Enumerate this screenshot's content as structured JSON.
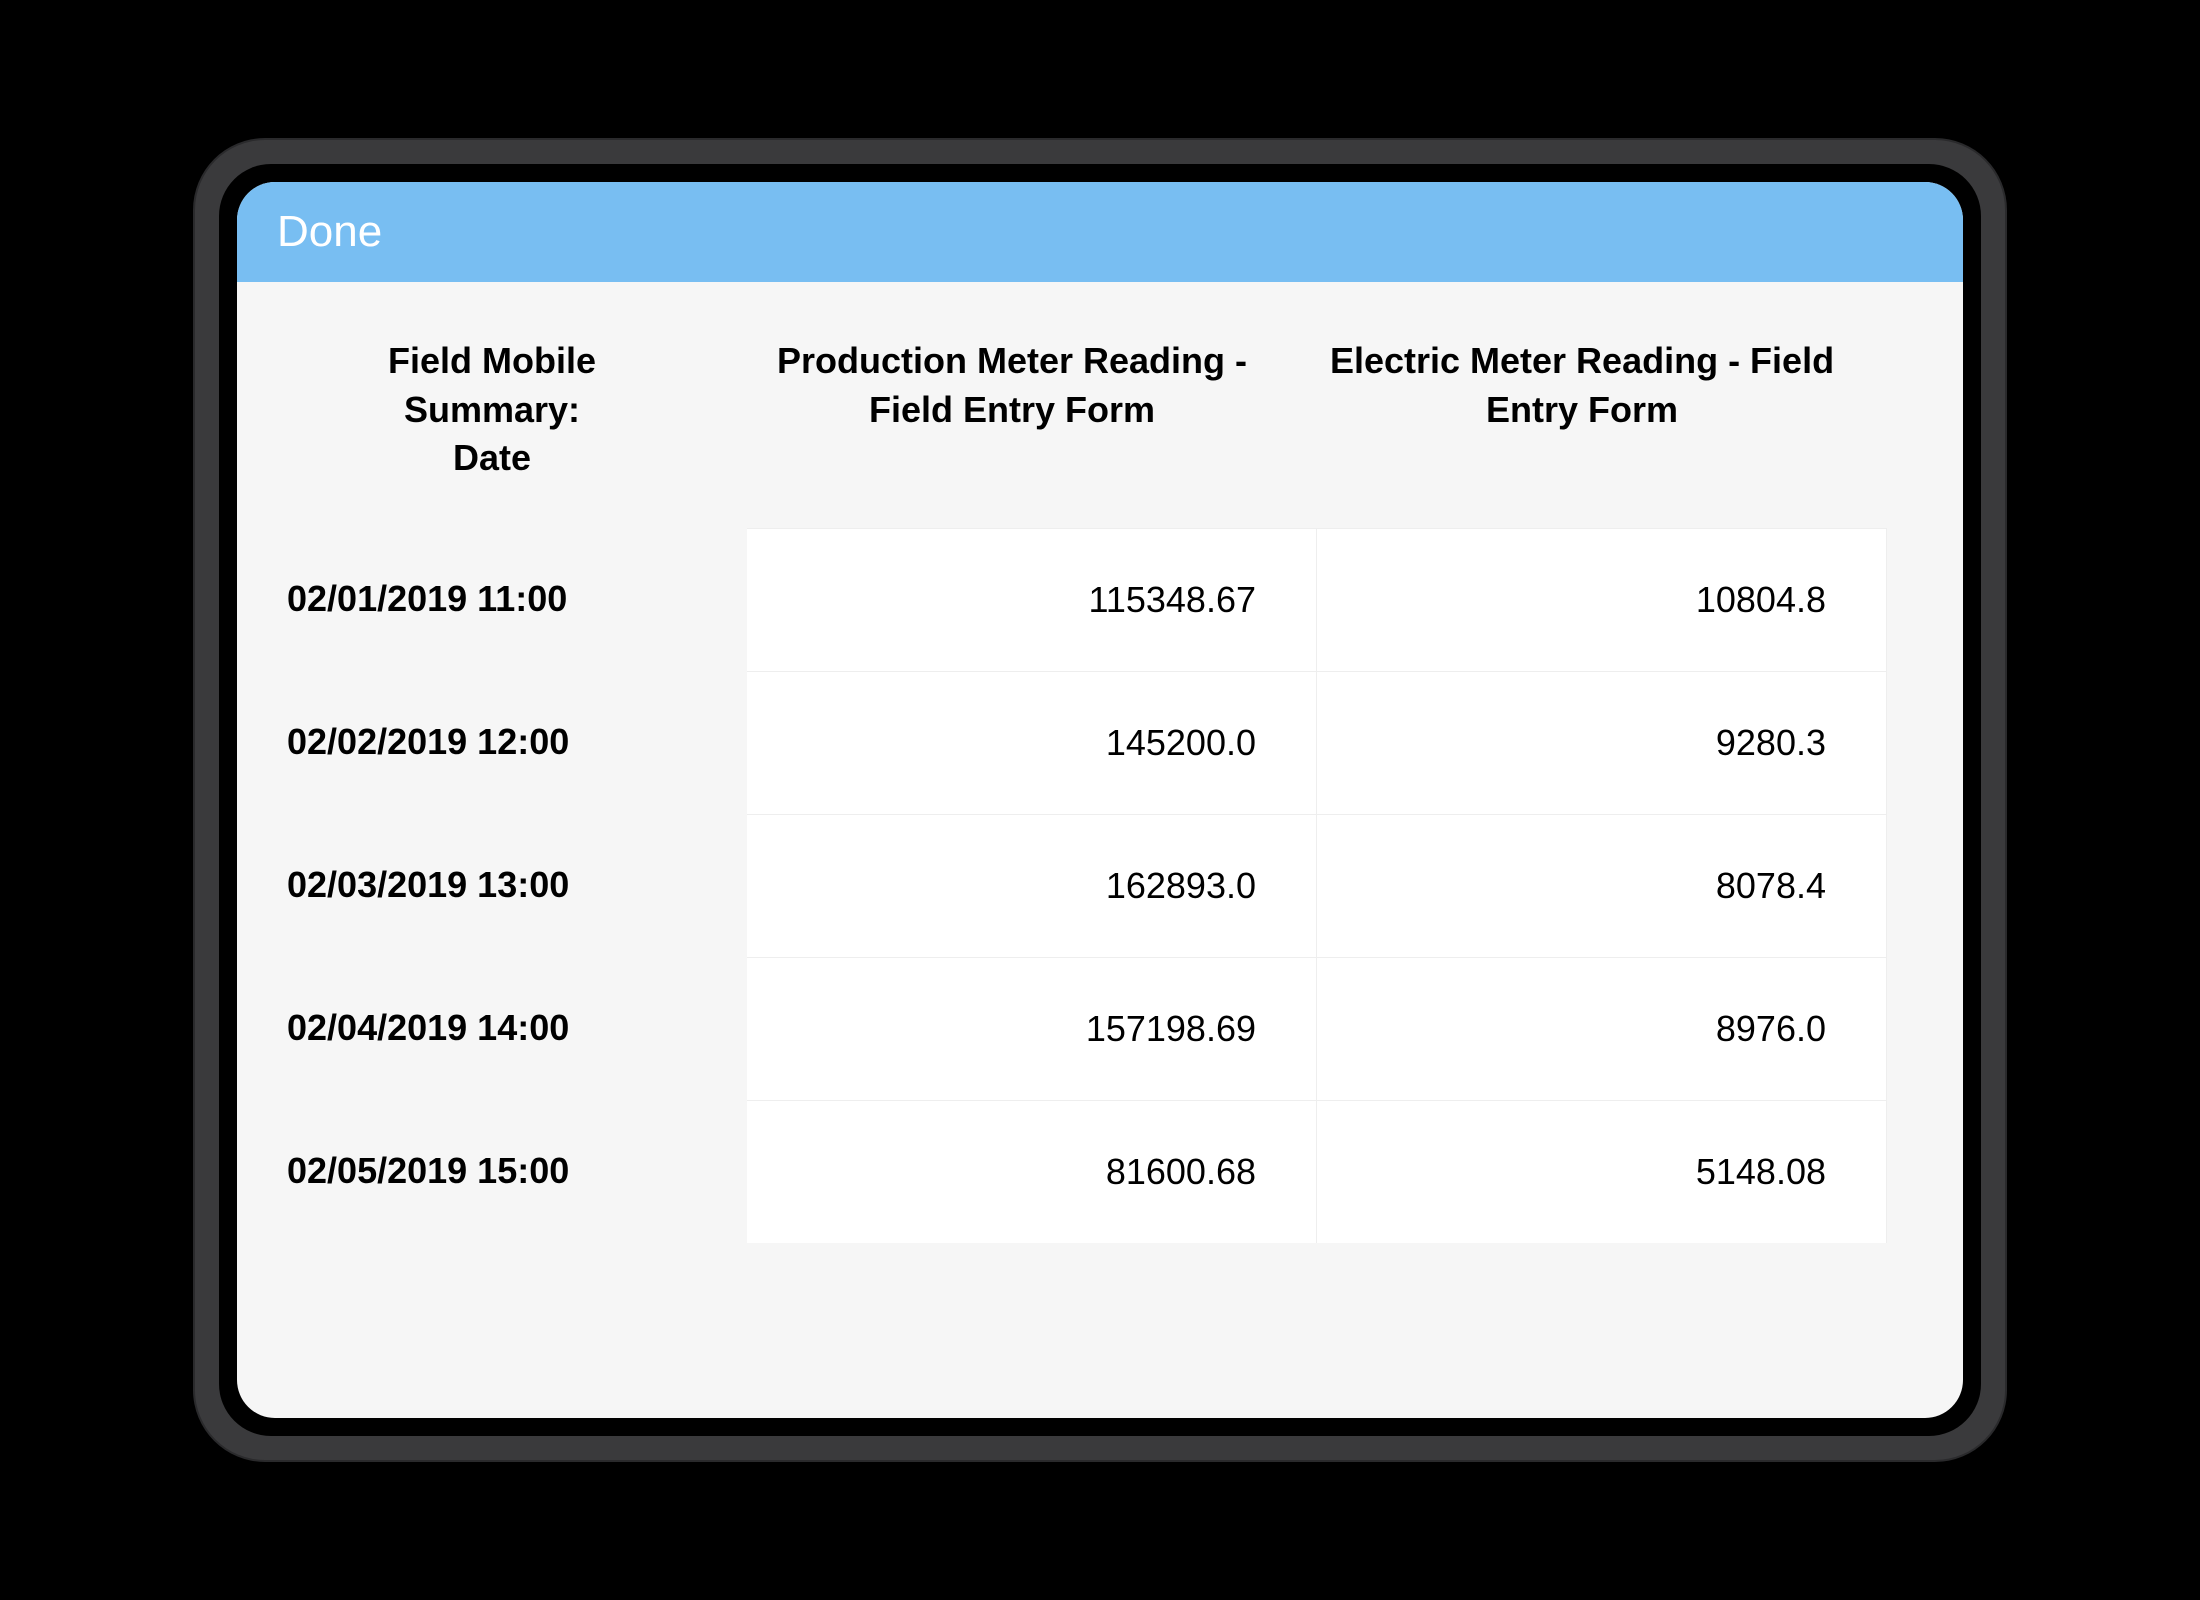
{
  "header": {
    "done_label": "Done"
  },
  "table": {
    "columns": {
      "date": "Field Mobile Summary:\nDate",
      "production": "Production Meter Reading - Field Entry Form",
      "electric": "Electric Meter Reading - Field Entry Form"
    },
    "rows": [
      {
        "date": "02/01/2019 11:00",
        "production": "115348.67",
        "electric": "10804.8"
      },
      {
        "date": "02/02/2019 12:00",
        "production": "145200.0",
        "electric": "9280.3"
      },
      {
        "date": "02/03/2019 13:00",
        "production": "162893.0",
        "electric": "8078.4"
      },
      {
        "date": "02/04/2019 14:00",
        "production": "157198.69",
        "electric": "8976.0"
      },
      {
        "date": "02/05/2019 15:00",
        "production": "81600.68",
        "electric": "5148.08"
      }
    ]
  }
}
